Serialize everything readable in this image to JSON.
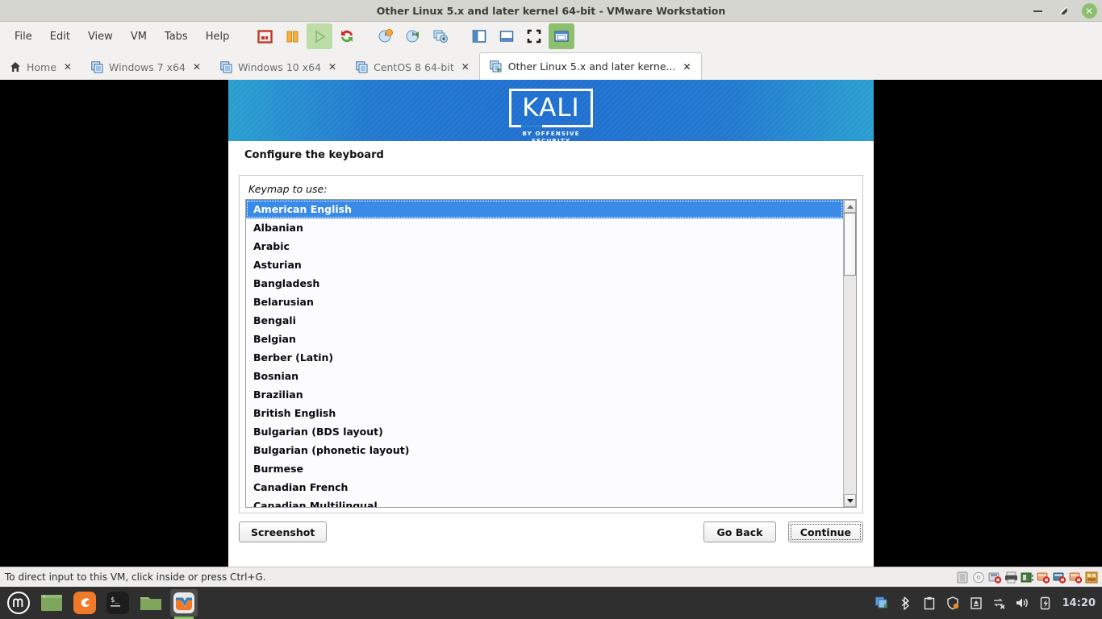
{
  "window": {
    "title": "Other Linux 5.x and later kernel 64-bit - VMware Workstation",
    "minimize_label": "Minimize",
    "maximize_label": "Restore",
    "close_label": "Close"
  },
  "menubar": {
    "items": [
      {
        "label": "File"
      },
      {
        "label": "Edit"
      },
      {
        "label": "View"
      },
      {
        "label": "VM"
      },
      {
        "label": "Tabs"
      },
      {
        "label": "Help"
      }
    ]
  },
  "toolbar": {
    "buttons": [
      {
        "name": "power-off-icon",
        "title": "Power off"
      },
      {
        "name": "suspend-icon",
        "title": "Suspend"
      },
      {
        "name": "play-icon",
        "title": "Power on"
      },
      {
        "name": "reset-icon",
        "title": "Restart guest"
      },
      {
        "name": "snapshot-take-icon",
        "title": "Take snapshot"
      },
      {
        "name": "snapshot-revert-icon",
        "title": "Revert snapshot"
      },
      {
        "name": "snapshot-manager-icon",
        "title": "Manage snapshots"
      },
      {
        "name": "sidebar-toggle-icon",
        "title": "Show or hide library"
      },
      {
        "name": "thumbnail-bar-icon",
        "title": "Show or hide thumbnail bar"
      },
      {
        "name": "fullscreen-icon",
        "title": "Enter full screen"
      },
      {
        "name": "unity-icon",
        "title": "Unity mode"
      }
    ]
  },
  "tabs": [
    {
      "label": "Home",
      "icon": "home-icon",
      "active": false,
      "closable": true
    },
    {
      "label": "Windows 7 x64",
      "icon": "vm-icon",
      "active": false,
      "closable": true
    },
    {
      "label": "Windows 10 x64",
      "icon": "vm-icon",
      "active": false,
      "closable": true
    },
    {
      "label": "CentOS 8 64-bit",
      "icon": "vm-icon",
      "active": false,
      "closable": true
    },
    {
      "label": "Other Linux 5.x and later kerne...",
      "icon": "vm-running-icon",
      "active": true,
      "closable": true
    }
  ],
  "installer": {
    "brand": {
      "name": "KALI",
      "tagline": "BY OFFENSIVE SECURITY"
    },
    "page_title": "Configure the keyboard",
    "field_label": "Keymap to use:",
    "selected_keymap": "American English",
    "keymaps": [
      "American English",
      "Albanian",
      "Arabic",
      "Asturian",
      "Bangladesh",
      "Belarusian",
      "Bengali",
      "Belgian",
      "Berber (Latin)",
      "Bosnian",
      "Brazilian",
      "British English",
      "Bulgarian (BDS layout)",
      "Bulgarian (phonetic layout)",
      "Burmese",
      "Canadian French",
      "Canadian Multilingual"
    ],
    "buttons": {
      "screenshot": "Screenshot",
      "go_back": "Go Back",
      "continue": "Continue"
    },
    "scrollbar": {
      "up_label": "Scroll up",
      "down_label": "Scroll down"
    }
  },
  "statusbar": {
    "message": "To direct input to this VM, click inside or press Ctrl+G.",
    "devices": [
      {
        "name": "hard-disk-icon",
        "title": "Hard disk"
      },
      {
        "name": "cd-dvd-icon",
        "title": "CD/DVD drive"
      },
      {
        "name": "floppy-disconnected-icon",
        "title": "Floppy disconnected"
      },
      {
        "name": "printer-icon",
        "title": "Printer"
      },
      {
        "name": "network-adapter-icon",
        "title": "Network adapter"
      },
      {
        "name": "usb-disconnected-icon",
        "title": "USB disconnected"
      },
      {
        "name": "sound-disconnected-icon",
        "title": "Sound card disconnected"
      },
      {
        "name": "camera-disconnected-icon",
        "title": "Camera disconnected"
      },
      {
        "name": "vm-settings-icon",
        "title": "Virtual machine settings"
      }
    ]
  },
  "taskbar": {
    "apps": [
      {
        "name": "mint-menu-button",
        "title": "Menu"
      },
      {
        "name": "show-desktop-button",
        "title": "Show desktop"
      },
      {
        "name": "firefox-button",
        "title": "Firefox"
      },
      {
        "name": "terminal-button",
        "title": "Terminal"
      },
      {
        "name": "files-button",
        "title": "Files"
      },
      {
        "name": "vmware-button",
        "title": "VMware Workstation",
        "running": true
      }
    ],
    "tray": [
      {
        "name": "vmware-tray-icon"
      },
      {
        "name": "bluetooth-icon"
      },
      {
        "name": "clipboard-icon"
      },
      {
        "name": "shield-icon"
      },
      {
        "name": "eject-icon"
      },
      {
        "name": "network-disconnected-icon"
      },
      {
        "name": "volume-icon"
      },
      {
        "name": "battery-icon"
      }
    ],
    "clock": "14:20"
  },
  "colors": {
    "kali_blue": "#2279cf",
    "selection_blue": "#3a8ae8",
    "titlebar_bg": "#d6d6d1",
    "taskbar_bg": "#2f2f2f",
    "accent_green": "#8dbf70"
  }
}
